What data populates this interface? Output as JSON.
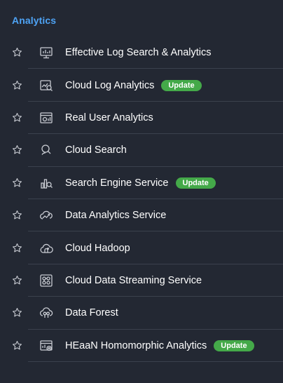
{
  "section": {
    "title": "Analytics"
  },
  "items": [
    {
      "label": "Effective Log Search & Analytics",
      "icon": "monitor-chart-icon",
      "badge": ""
    },
    {
      "label": "Cloud Log Analytics",
      "icon": "log-chart-search-icon",
      "badge": "Update"
    },
    {
      "label": "Real User Analytics",
      "icon": "browser-analytics-icon",
      "badge": ""
    },
    {
      "label": "Cloud Search",
      "icon": "cloud-search-icon",
      "badge": ""
    },
    {
      "label": "Search Engine Service",
      "icon": "search-engine-icon",
      "badge": "Update"
    },
    {
      "label": "Data Analytics Service",
      "icon": "cloud-analytics-icon",
      "badge": ""
    },
    {
      "label": "Cloud Hadoop",
      "icon": "cloud-hadoop-icon",
      "badge": ""
    },
    {
      "label": "Cloud Data Streaming Service",
      "icon": "data-streaming-icon",
      "badge": ""
    },
    {
      "label": "Data Forest",
      "icon": "data-forest-icon",
      "badge": ""
    },
    {
      "label": "HEaaN Homomorphic Analytics",
      "icon": "homomorphic-analytics-icon",
      "badge": "Update"
    }
  ],
  "colors": {
    "background": "#232833",
    "accent": "#4ea3f5",
    "badge": "#44a949",
    "divider": "#3b414d",
    "icon": "#c9ccd3"
  }
}
